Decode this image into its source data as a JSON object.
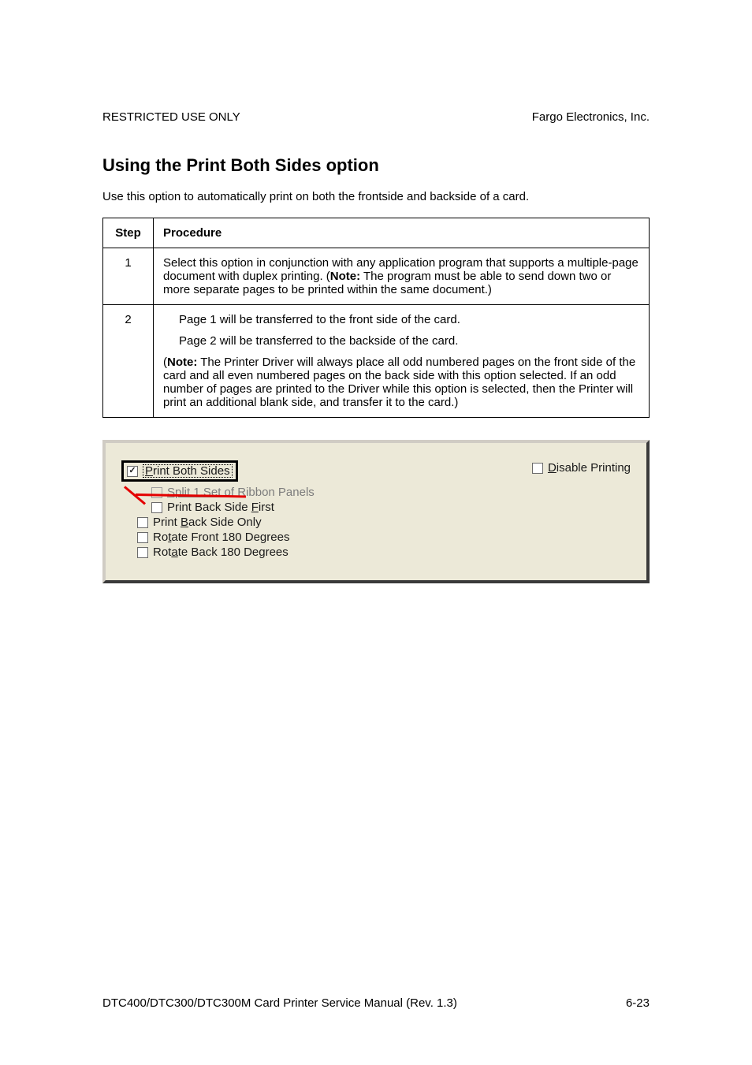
{
  "header": {
    "left": "RESTRICTED USE ONLY",
    "right": "Fargo Electronics, Inc."
  },
  "section_title": "Using the Print Both Sides option",
  "intro": "Use this option to automatically print on both the frontside and backside of a card.",
  "table": {
    "headers": {
      "step": "Step",
      "procedure": "Procedure"
    },
    "rows": [
      {
        "step": "1",
        "p1a": "Select this option in conjunction with any application program that supports a multiple-page document with duplex printing. (",
        "p1b": "Note:",
        "p1c": "  The program must be able to send down two or more separate pages to be printed within the same document.)"
      },
      {
        "step": "2",
        "p1": "Page 1 will be transferred to the front side of the card.",
        "p2": "Page 2 will be transferred to the backside of the card.",
        "p3a": "(",
        "p3b": "Note:",
        "p3c": "  The Printer Driver will always place all odd numbered pages on the front side of the card and all even numbered pages on the back side with this option selected. If an odd number of pages are printed to the Driver while this option is selected, then the Printer will print an additional blank side, and transfer it to the card.)"
      }
    ]
  },
  "dialog": {
    "print_both_pre": "P",
    "print_both_post": "rint Both Sides",
    "split_prefix": "Split 1 Set of R",
    "split_suffix": "ibbon Panels",
    "print_back_first_a": "Print Back Side ",
    "print_back_first_b": "F",
    "print_back_first_c": "irst",
    "print_back_only_a": "Print ",
    "print_back_only_b": "B",
    "print_back_only_c": "ack Side Only",
    "rotate_front_a": "Ro",
    "rotate_front_b": "t",
    "rotate_front_c": "ate Front 180 Degrees",
    "rotate_back_a": "Rot",
    "rotate_back_b": "a",
    "rotate_back_c": "te Back 180 Degrees",
    "disable_a": "D",
    "disable_b": "isable Printing"
  },
  "footer": {
    "left": "DTC400/DTC300/DTC300M Card Printer Service Manual (Rev. 1.3)",
    "right": "6-23"
  }
}
